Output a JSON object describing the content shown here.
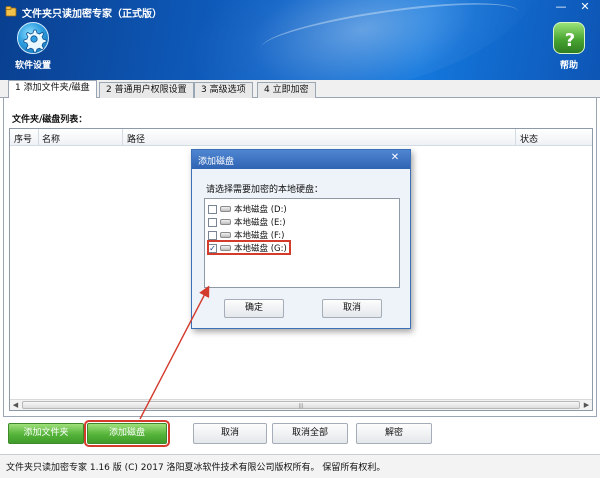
{
  "window": {
    "title": "文件夹只读加密专家（正式版）",
    "minimize": "—",
    "close": "✕"
  },
  "toolbar": {
    "settings_label": "软件设置",
    "help_label": "帮助"
  },
  "tabs": [
    {
      "label": "1 添加文件夹/磁盘",
      "active": true
    },
    {
      "label": "2 普通用户权限设置",
      "active": false
    },
    {
      "label": "3 高级选项",
      "active": false
    },
    {
      "label": "4 立即加密",
      "active": false
    }
  ],
  "list": {
    "section_label": "文件夹/磁盘列表：",
    "columns": [
      "序号",
      "名称",
      "路径",
      "状态"
    ]
  },
  "buttons": {
    "add_folder": "添加文件夹",
    "add_disk": "添加磁盘",
    "cancel": "取消",
    "cancel_all": "取消全部",
    "decrypt": "解密"
  },
  "status_bar": {
    "text": "文件夹只读加密专家 1.16 版 (C) 2017 洛阳夏冰软件技术有限公司版权所有。 保留所有权利。"
  },
  "dialog": {
    "title": "添加磁盘",
    "close": "✕",
    "prompt": "请选择需要加密的本地硬盘：",
    "drives": [
      {
        "label": "本地磁盘 (D:)",
        "checked": false
      },
      {
        "label": "本地磁盘 (E:)",
        "checked": false
      },
      {
        "label": "本地磁盘 (F:)",
        "checked": false
      },
      {
        "label": "本地磁盘 (G:)",
        "checked": true
      }
    ],
    "ok": "确定",
    "cancel": "取消"
  },
  "colors": {
    "header_blue": "#0f62c6",
    "highlight_red": "#d33b2c",
    "green_button": "#55b43a"
  }
}
